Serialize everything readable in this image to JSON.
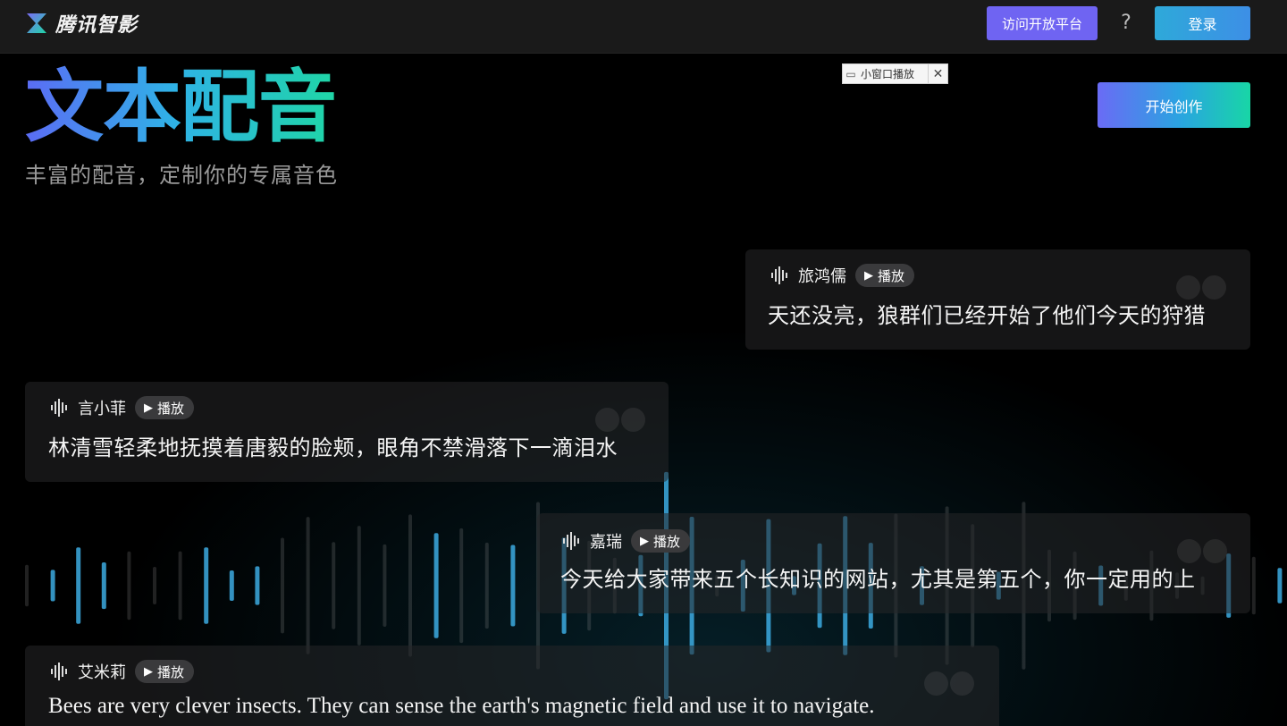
{
  "header": {
    "logo_text": "腾讯智影",
    "platform_button": "访问开放平台",
    "help_symbol": "?",
    "login_button": "登录"
  },
  "hero": {
    "title_part1": "文本",
    "title_part2": "配音",
    "subtitle": "丰富的配音，定制你的专属音色",
    "create_button": "开始创作"
  },
  "mini_player": {
    "label": "小窗口播放",
    "close_symbol": "✕"
  },
  "voices": [
    {
      "name": "旅鸿儒",
      "play_label": "播放",
      "text": "天还没亮，狼群们已经开始了他们今天的狩猎"
    },
    {
      "name": "言小菲",
      "play_label": "播放",
      "text": "林清雪轻柔地抚摸着唐毅的脸颊，眼角不禁滑落下一滴泪水"
    },
    {
      "name": "嘉瑞",
      "play_label": "播放",
      "text": "今天给大家带来五个长知识的网站，尤其是第五个，你一定用的上"
    },
    {
      "name": "艾米莉",
      "play_label": "播放",
      "text": "Bees are very clever insects. They can sense the earth's magnetic field and use it to navigate."
    }
  ],
  "colors": {
    "brand_purple": "#6f64f2",
    "brand_teal": "#1fd6a6",
    "brand_blue": "#2ea9d9"
  },
  "icons": {
    "play": "▶",
    "tv": "📺"
  }
}
